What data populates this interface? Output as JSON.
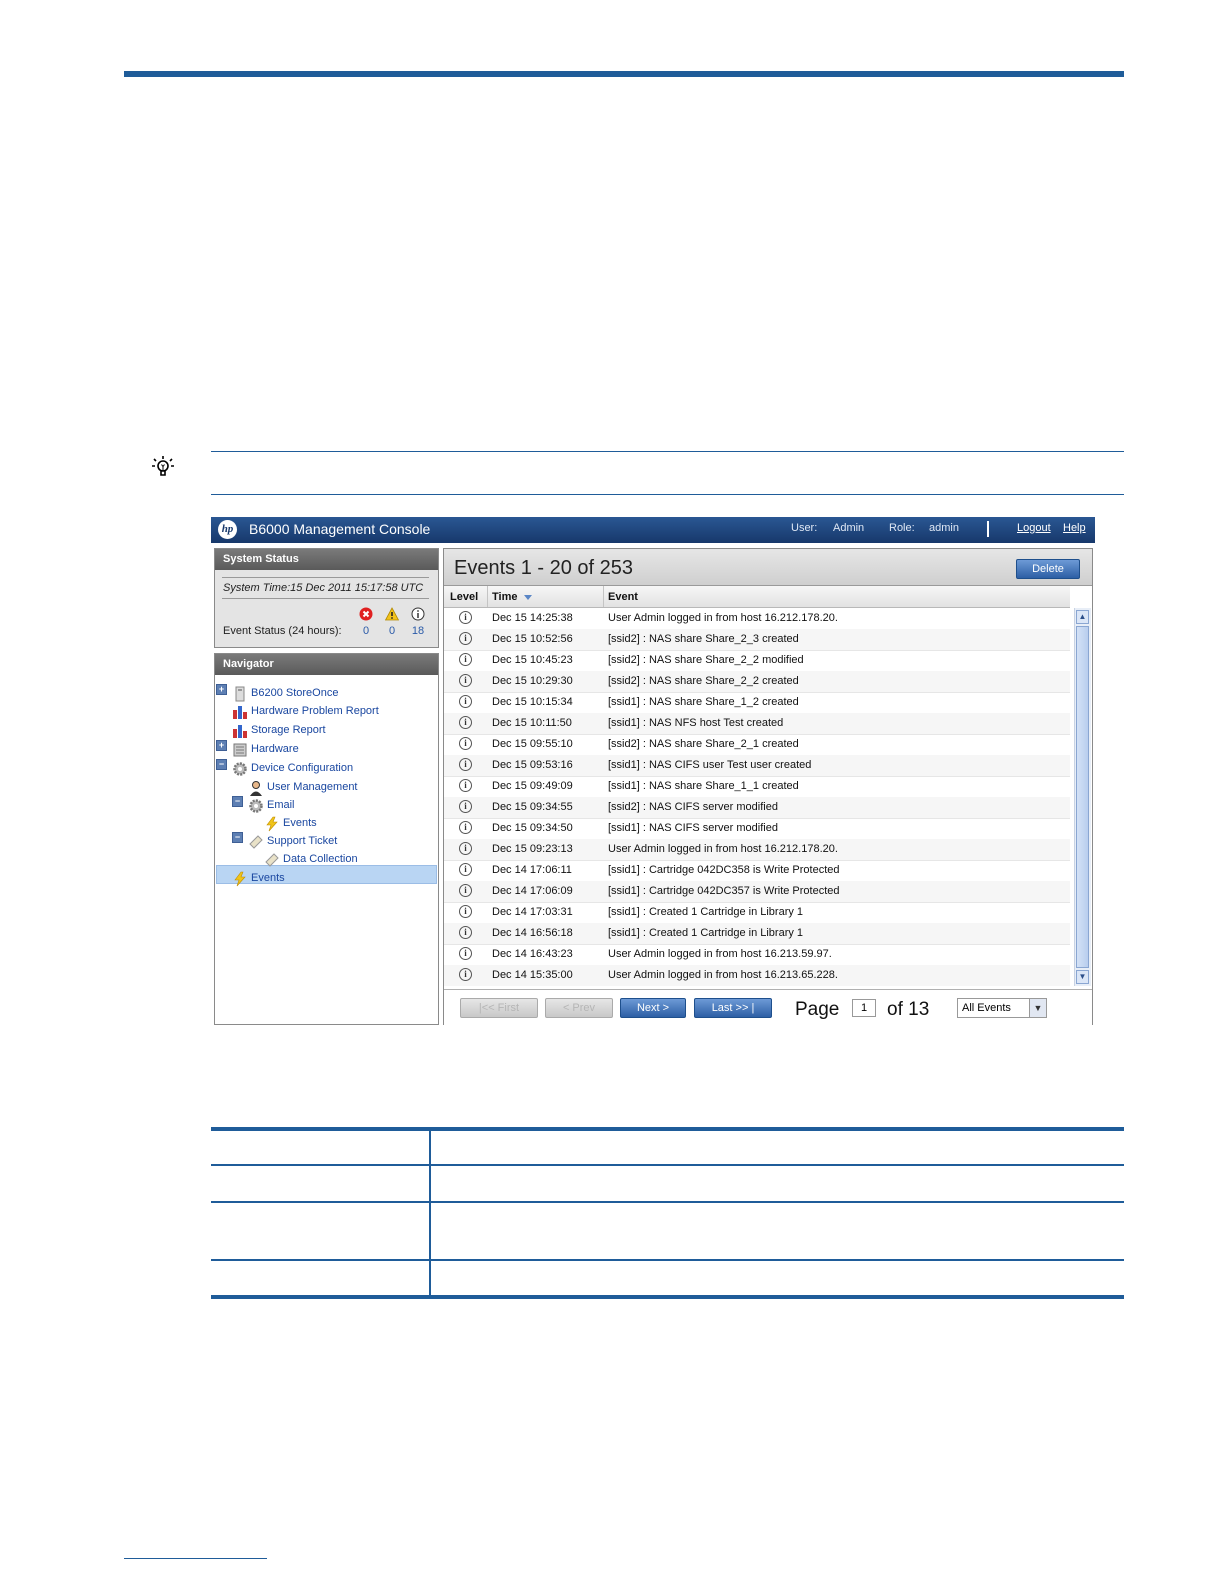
{
  "console": {
    "app_title": "B6000 Management Console",
    "logo_text": "hp",
    "user_label": "User:",
    "user_value": "Admin",
    "role_label": "Role:",
    "role_value": "admin",
    "logout": "Logout",
    "help": "Help"
  },
  "system_status": {
    "heading": "System Status",
    "system_time": "System Time:15 Dec 2011 15:17:58 UTC",
    "event_status_label": "Event Status (24 hours):",
    "critical_count": "0",
    "warning_count": "0",
    "info_count": "18"
  },
  "navigator": {
    "heading": "Navigator",
    "items": [
      {
        "label": "B6200 StoreOnce"
      },
      {
        "label": "Hardware Problem Report"
      },
      {
        "label": "Storage Report"
      },
      {
        "label": "Hardware"
      },
      {
        "label": "Device Configuration"
      },
      {
        "label": "User Management"
      },
      {
        "label": "Email"
      },
      {
        "label": "Events"
      },
      {
        "label": "Support Ticket"
      },
      {
        "label": "Data Collection"
      },
      {
        "label": "Events"
      }
    ]
  },
  "events": {
    "title": "Events 1 - 20 of 253",
    "delete_button": "Delete",
    "columns": {
      "level": "Level",
      "time": "Time",
      "event": "Event"
    },
    "rows": [
      {
        "time": "Dec 15 14:25:38",
        "event": "User Admin logged in from host 16.212.178.20."
      },
      {
        "time": "Dec 15 10:52:56",
        "event": "[ssid2] : NAS share Share_2_3 created"
      },
      {
        "time": "Dec 15 10:45:23",
        "event": "[ssid2] : NAS share Share_2_2 modified"
      },
      {
        "time": "Dec 15 10:29:30",
        "event": "[ssid2] : NAS share Share_2_2 created"
      },
      {
        "time": "Dec 15 10:15:34",
        "event": "[ssid1] : NAS share Share_1_2 created"
      },
      {
        "time": "Dec 15 10:11:50",
        "event": "[ssid1] : NAS NFS host Test created"
      },
      {
        "time": "Dec 15 09:55:10",
        "event": "[ssid2] : NAS share Share_2_1 created"
      },
      {
        "time": "Dec 15 09:53:16",
        "event": "[ssid1] : NAS CIFS user Test user created"
      },
      {
        "time": "Dec 15 09:49:09",
        "event": "[ssid1] : NAS share Share_1_1 created"
      },
      {
        "time": "Dec 15 09:34:55",
        "event": "[ssid2] : NAS CIFS server modified"
      },
      {
        "time": "Dec 15 09:34:50",
        "event": "[ssid1] : NAS CIFS server modified"
      },
      {
        "time": "Dec 15 09:23:13",
        "event": "User Admin logged in from host 16.212.178.20."
      },
      {
        "time": "Dec 14 17:06:11",
        "event": "[ssid1] : Cartridge 042DC358 is Write Protected"
      },
      {
        "time": "Dec 14 17:06:09",
        "event": "[ssid1] : Cartridge 042DC357 is Write Protected"
      },
      {
        "time": "Dec 14 17:03:31",
        "event": "[ssid1] : Created 1 Cartridge in Library 1"
      },
      {
        "time": "Dec 14 16:56:18",
        "event": "[ssid1] : Created 1 Cartridge in Library 1"
      },
      {
        "time": "Dec 14 16:43:23",
        "event": "User Admin logged in from host 16.213.59.97."
      },
      {
        "time": "Dec 14 15:35:00",
        "event": "User Admin logged in from host 16.213.65.228."
      }
    ],
    "pager": {
      "first": "|<< First",
      "prev": "< Prev",
      "next": "Next >",
      "last": "Last >> |",
      "page_label": "Page",
      "page_value": "1",
      "of_label": "of 13",
      "filter_value": "All Events"
    }
  },
  "colors": {
    "rule_blue": "#1f5c99",
    "titlebar": "#17386b",
    "selected_row": "#b9d5f3"
  }
}
